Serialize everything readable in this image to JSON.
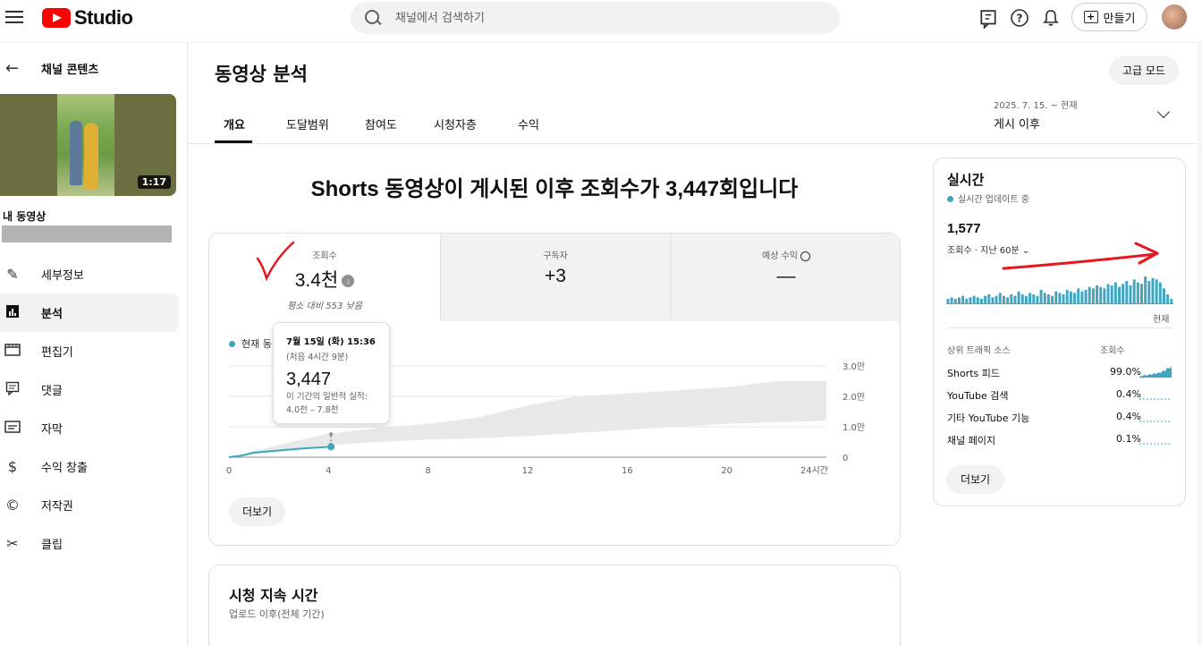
{
  "header": {
    "logo_text": "Studio",
    "search_placeholder": "채널에서 검색하기",
    "create_label": "만들기"
  },
  "sidebar": {
    "back_label": "채널 콘텐츠",
    "thumbnail_duration": "1:17",
    "my_video_label": "내 동영상",
    "items": [
      {
        "label": "세부정보",
        "icon": "pencil-icon"
      },
      {
        "label": "분석",
        "icon": "analytics-icon"
      },
      {
        "label": "편집기",
        "icon": "clapper-icon"
      },
      {
        "label": "댓글",
        "icon": "comment-icon"
      },
      {
        "label": "자막",
        "icon": "subtitles-icon"
      },
      {
        "label": "수익 창출",
        "icon": "dollar-icon"
      },
      {
        "label": "저작권",
        "icon": "copyright-icon"
      },
      {
        "label": "클립",
        "icon": "scissors-icon"
      }
    ]
  },
  "main": {
    "title": "동영상 분석",
    "advanced_button": "고급 모드",
    "tabs": [
      "개요",
      "도달범위",
      "참여도",
      "시청자층",
      "수익"
    ],
    "date_range": {
      "dates": "2025. 7. 15. ~ 현재",
      "label": "게시 이후"
    },
    "headline": "Shorts 동영상이 게시된 이후 조회수가 3,447회입니다",
    "metrics": [
      {
        "label": "조회수",
        "value": "3.4천",
        "sub": "평소 대비 553 낮음"
      },
      {
        "label": "구독자",
        "value": "+3"
      },
      {
        "label": "예상 수익",
        "value": "—"
      }
    ],
    "legend_label": "현재 동",
    "more_button": "더보기",
    "tooltip": {
      "date": "7월 15일 (화) 15:36",
      "since": "(처음 4시간 9분)",
      "value": "3,447",
      "typical_label": "이 기간의 일반적 실적:",
      "typical_range": "4.0천 – 7.8천"
    },
    "watch_time": {
      "title": "시청 지속 시간",
      "subtitle": "업로드 이후(전체 기간)"
    }
  },
  "chart_data": {
    "type": "line",
    "x_ticks": [
      "0",
      "4",
      "8",
      "12",
      "16",
      "20",
      "24시간"
    ],
    "y_ticks": [
      "3.0만",
      "2.0만",
      "1.0만",
      "0"
    ],
    "xlim": [
      0,
      24
    ],
    "ylim": [
      0,
      30000
    ],
    "series": [
      {
        "x": [
          0,
          0.5,
          1,
          2,
          3,
          4.1
        ],
        "y": [
          0,
          500,
          1500,
          2200,
          2900,
          3447
        ]
      }
    ],
    "typical_band": {
      "x": [
        0,
        1,
        2,
        4,
        6,
        8,
        10,
        12,
        14,
        16,
        18,
        20,
        22,
        24
      ],
      "low": [
        0,
        1000,
        1800,
        4000,
        5000,
        5800,
        6200,
        7000,
        8000,
        9000,
        10000,
        11000,
        11500,
        12000
      ],
      "high": [
        0,
        2000,
        4000,
        7800,
        9500,
        11000,
        13000,
        17000,
        20000,
        21000,
        22000,
        23000,
        25000,
        25000
      ]
    }
  },
  "realtime": {
    "title": "실시간",
    "live_label": "실시간 업데이트 중",
    "value": "1,577",
    "period_label": "조회수 · 지난 60분",
    "now_label": "현재",
    "bars": [
      3,
      4,
      3,
      4,
      5,
      3,
      4,
      5,
      4,
      3,
      5,
      6,
      4,
      5,
      7,
      5,
      4,
      6,
      5,
      8,
      6,
      5,
      7,
      6,
      5,
      9,
      7,
      6,
      5,
      8,
      7,
      6,
      9,
      8,
      7,
      10,
      8,
      9,
      11,
      10,
      12,
      11,
      10,
      13,
      12,
      14,
      11,
      13,
      15,
      12,
      16,
      14,
      13,
      18,
      15,
      17,
      16,
      14,
      10,
      6,
      3
    ],
    "source_header": {
      "name": "상위 트래픽 소스",
      "value": "조회수"
    },
    "sources": [
      {
        "name": "Shorts 피드",
        "percent": "99.0%"
      },
      {
        "name": "YouTube 검색",
        "percent": "0.4%"
      },
      {
        "name": "기타 YouTube 기능",
        "percent": "0.4%"
      },
      {
        "name": "채널 페이지",
        "percent": "0.1%"
      }
    ],
    "more_button": "더보기"
  },
  "colors": {
    "accent": "#3ea6c0",
    "annotation": "#e8141e",
    "youtube_red": "#ff0000"
  }
}
